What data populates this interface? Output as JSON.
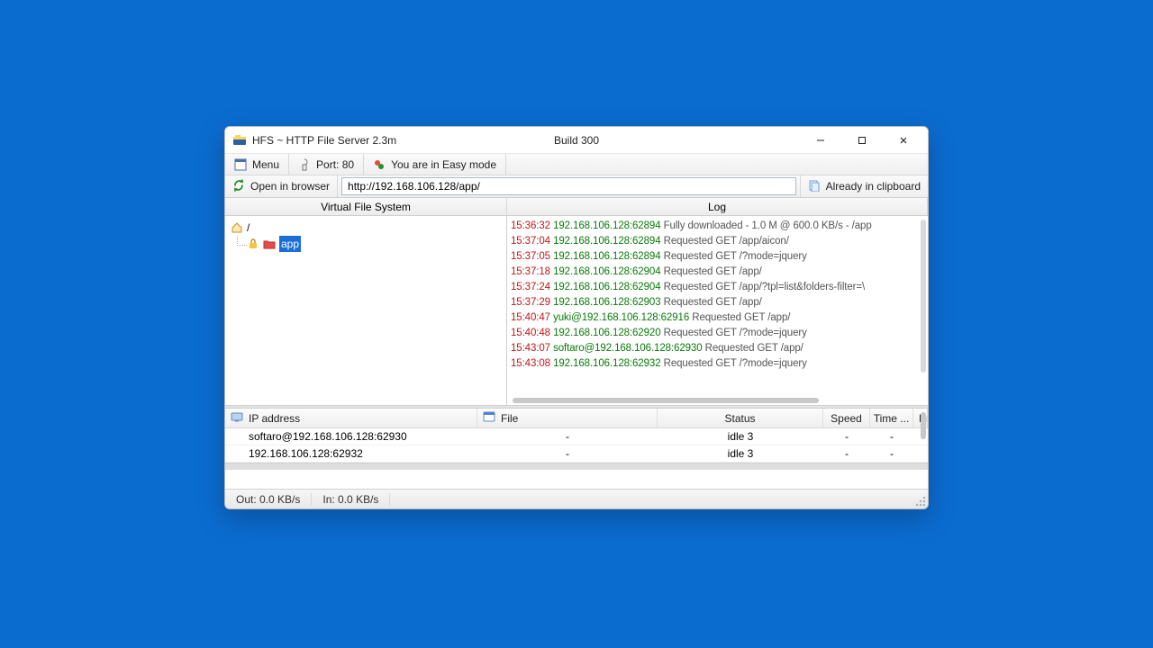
{
  "window": {
    "title": "HFS ~ HTTP File Server 2.3m",
    "build": "Build 300"
  },
  "toolbar": {
    "menu": "Menu",
    "port": "Port: 80",
    "easy_mode": "You are in Easy mode"
  },
  "addressbar": {
    "open_browser": "Open in browser",
    "url": "http://192.168.106.128/app/",
    "clipboard": "Already in clipboard"
  },
  "panes": {
    "vfs_header": "Virtual File System",
    "log_header": "Log"
  },
  "vfs": {
    "root": "/",
    "selected_folder": "app"
  },
  "log": [
    {
      "time": "15:36:32",
      "ip": "192.168.106.128:62894",
      "msg": "Fully downloaded - 1.0 M @ 600.0 KB/s - /app"
    },
    {
      "time": "15:37:04",
      "ip": "192.168.106.128:62894",
      "msg": "Requested GET /app/aicon/"
    },
    {
      "time": "15:37:05",
      "ip": "192.168.106.128:62894",
      "msg": "Requested GET /?mode=jquery"
    },
    {
      "time": "15:37:18",
      "ip": "192.168.106.128:62904",
      "msg": "Requested GET /app/"
    },
    {
      "time": "15:37:24",
      "ip": "192.168.106.128:62904",
      "msg": "Requested GET /app/?tpl=list&folders-filter=\\"
    },
    {
      "time": "15:37:29",
      "ip": "192.168.106.128:62903",
      "msg": "Requested GET /app/"
    },
    {
      "time": "15:40:47",
      "ip": "yuki@192.168.106.128:62916",
      "msg": "Requested GET /app/"
    },
    {
      "time": "15:40:48",
      "ip": "192.168.106.128:62920",
      "msg": "Requested GET /?mode=jquery"
    },
    {
      "time": "15:43:07",
      "ip": "softaro@192.168.106.128:62930",
      "msg": "Requested GET /app/"
    },
    {
      "time": "15:43:08",
      "ip": "192.168.106.128:62932",
      "msg": "Requested GET /?mode=jquery"
    }
  ],
  "conn": {
    "headers": {
      "ip": "IP address",
      "file": "File",
      "status": "Status",
      "speed": "Speed",
      "time": "Time ...",
      "progress": "Progre"
    },
    "rows": [
      {
        "ip": "softaro@192.168.106.128:62930",
        "file": "-",
        "status": "idle 3",
        "speed": "-",
        "time": "-",
        "progress": ""
      },
      {
        "ip": "192.168.106.128:62932",
        "file": "-",
        "status": "idle 3",
        "speed": "-",
        "time": "-",
        "progress": ""
      }
    ]
  },
  "status": {
    "out": "Out: 0.0 KB/s",
    "in": "In: 0.0 KB/s"
  }
}
